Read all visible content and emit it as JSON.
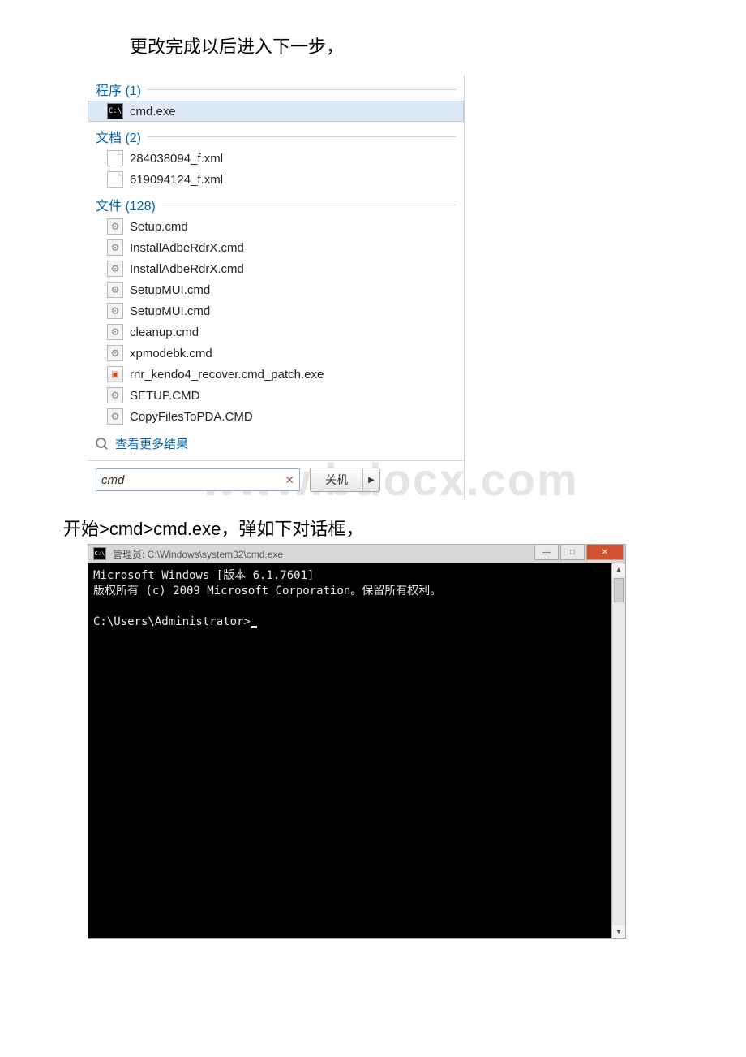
{
  "caption_top": "更改完成以后进入下一步，",
  "caption_bottom": "开始>cmd>cmd.exe，弹如下对话框，",
  "groups": {
    "programs": {
      "label": "程序 (1)"
    },
    "documents": {
      "label": "文档 (2)"
    },
    "files": {
      "label": "文件 (128)"
    }
  },
  "programs": [
    {
      "name": "cmd.exe",
      "icon": "cmd"
    }
  ],
  "documents": [
    {
      "name": "284038094_f.xml",
      "icon": "doc"
    },
    {
      "name": "619094124_f.xml",
      "icon": "doc"
    }
  ],
  "files": [
    {
      "name": "Setup.cmd",
      "icon": "gear"
    },
    {
      "name": "InstallAdbeRdrX.cmd",
      "icon": "gear"
    },
    {
      "name": "InstallAdbeRdrX.cmd",
      "icon": "gear"
    },
    {
      "name": "SetupMUI.cmd",
      "icon": "gear"
    },
    {
      "name": "SetupMUI.cmd",
      "icon": "gear"
    },
    {
      "name": "cleanup.cmd",
      "icon": "gear"
    },
    {
      "name": "xpmodebk.cmd",
      "icon": "gear"
    },
    {
      "name": "rnr_kendo4_recover.cmd_patch.exe",
      "icon": "exe"
    },
    {
      "name": "SETUP.CMD",
      "icon": "gear"
    },
    {
      "name": "CopyFilesToPDA.CMD",
      "icon": "gear"
    }
  ],
  "more_results": "查看更多结果",
  "search_input": "cmd",
  "shutdown_label": "关机",
  "watermark": "www.bdocx.com",
  "console": {
    "title": "管理员: C:\\Windows\\system32\\cmd.exe",
    "line1": "Microsoft Windows [版本 6.1.7601]",
    "line2": "版权所有 (c) 2009 Microsoft Corporation。保留所有权利。",
    "prompt": "C:\\Users\\Administrator>"
  }
}
